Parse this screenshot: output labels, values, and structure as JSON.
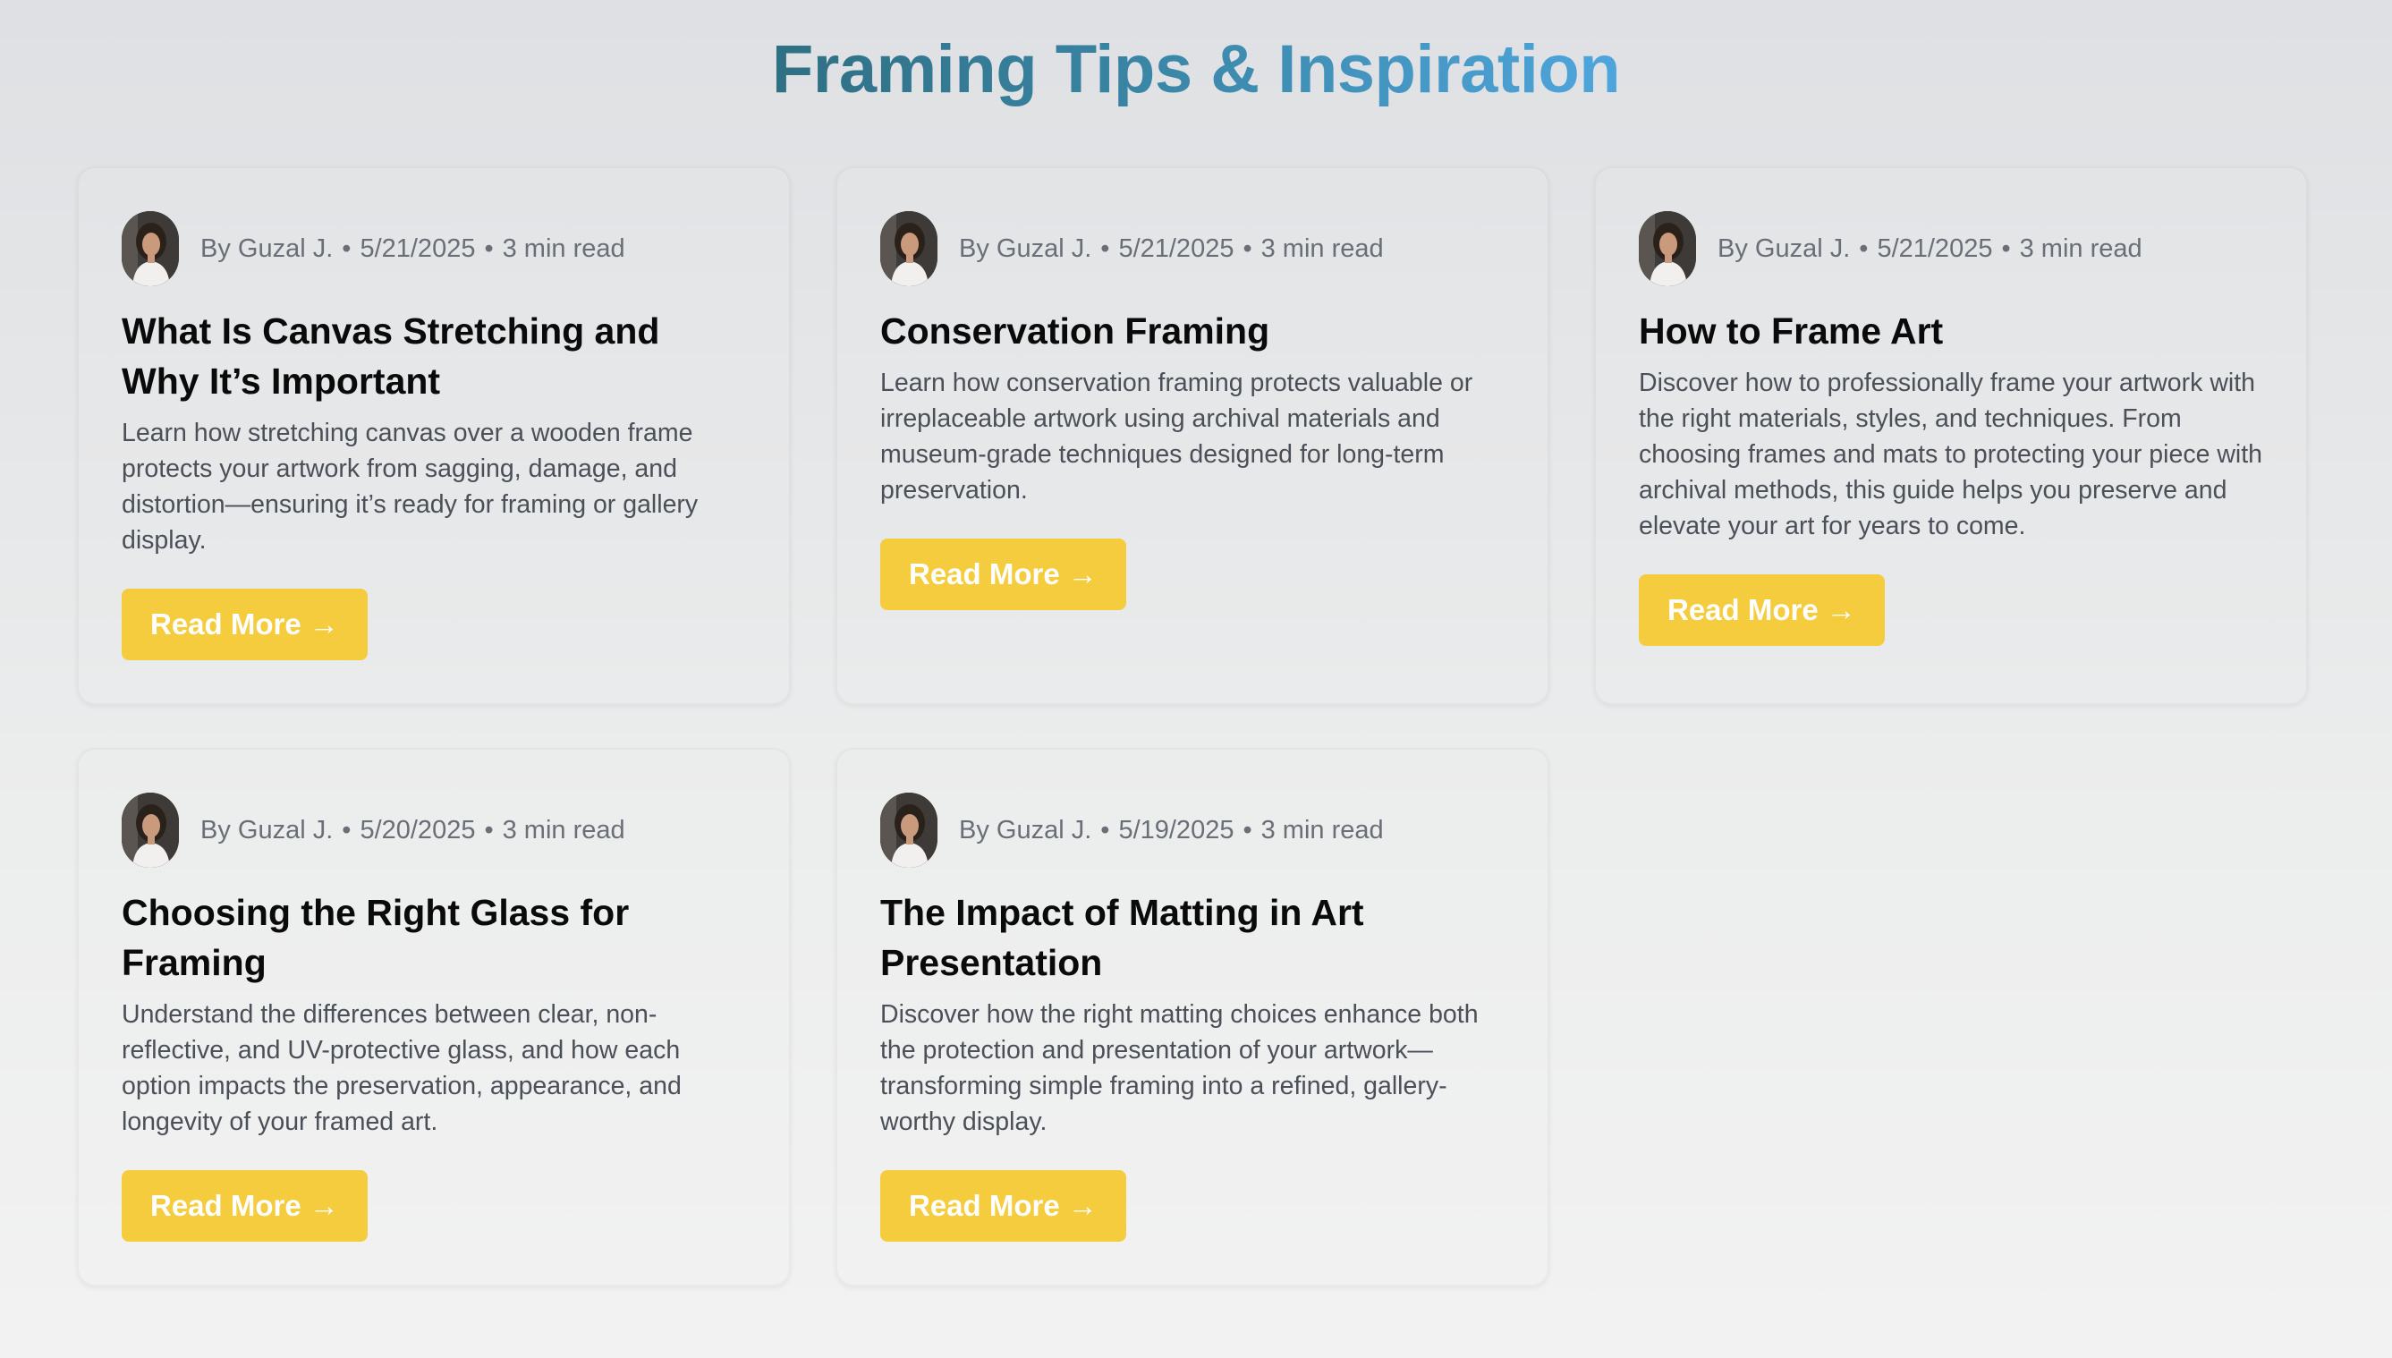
{
  "page": {
    "title": "Framing Tips & Inspiration"
  },
  "posts": [
    {
      "author": "By Guzal J.",
      "date": "5/21/2025",
      "read_time": "3 min read",
      "title": "What Is Canvas Stretching and Why It’s Important",
      "excerpt": "Learn how stretching canvas over a wooden frame protects your artwork from sagging, damage, and distortion—ensuring it’s ready for framing or gallery display.",
      "button": "Read More →"
    },
    {
      "author": "By Guzal J.",
      "date": "5/21/2025",
      "read_time": "3 min read",
      "title": "Conservation Framing",
      "excerpt": "Learn how conservation framing protects valuable or irreplaceable artwork using archival materials and museum-grade techniques designed for long-term preservation.",
      "button": "Read More →"
    },
    {
      "author": "By Guzal J.",
      "date": "5/21/2025",
      "read_time": "3 min read",
      "title": "How to Frame Art",
      "excerpt": "Discover how to professionally frame your artwork with the right materials, styles, and techniques. From choosing frames and mats to protecting your piece with archival methods, this guide helps you preserve and elevate your art for years to come.",
      "button": "Read More →"
    },
    {
      "author": "By Guzal J.",
      "date": "5/20/2025",
      "read_time": "3 min read",
      "title": "Choosing the Right Glass for Framing",
      "excerpt": "Understand the differences between clear, non-reflective, and UV-protective glass, and how each option impacts the preservation, appearance, and longevity of your framed art.",
      "button": "Read More →"
    },
    {
      "author": "By Guzal J.",
      "date": "5/19/2025",
      "read_time": "3 min read",
      "title": "The Impact of Matting in Art Presentation",
      "excerpt": "Discover how the right matting choices enhance both the protection and presentation of your artwork—transforming simple framing into a refined, gallery-worthy display.",
      "button": "Read More →"
    }
  ],
  "colors": {
    "button_bg": "#f4cc3e",
    "title_gradient_start": "#2f6f83",
    "title_gradient_end": "#4fa6dd"
  }
}
